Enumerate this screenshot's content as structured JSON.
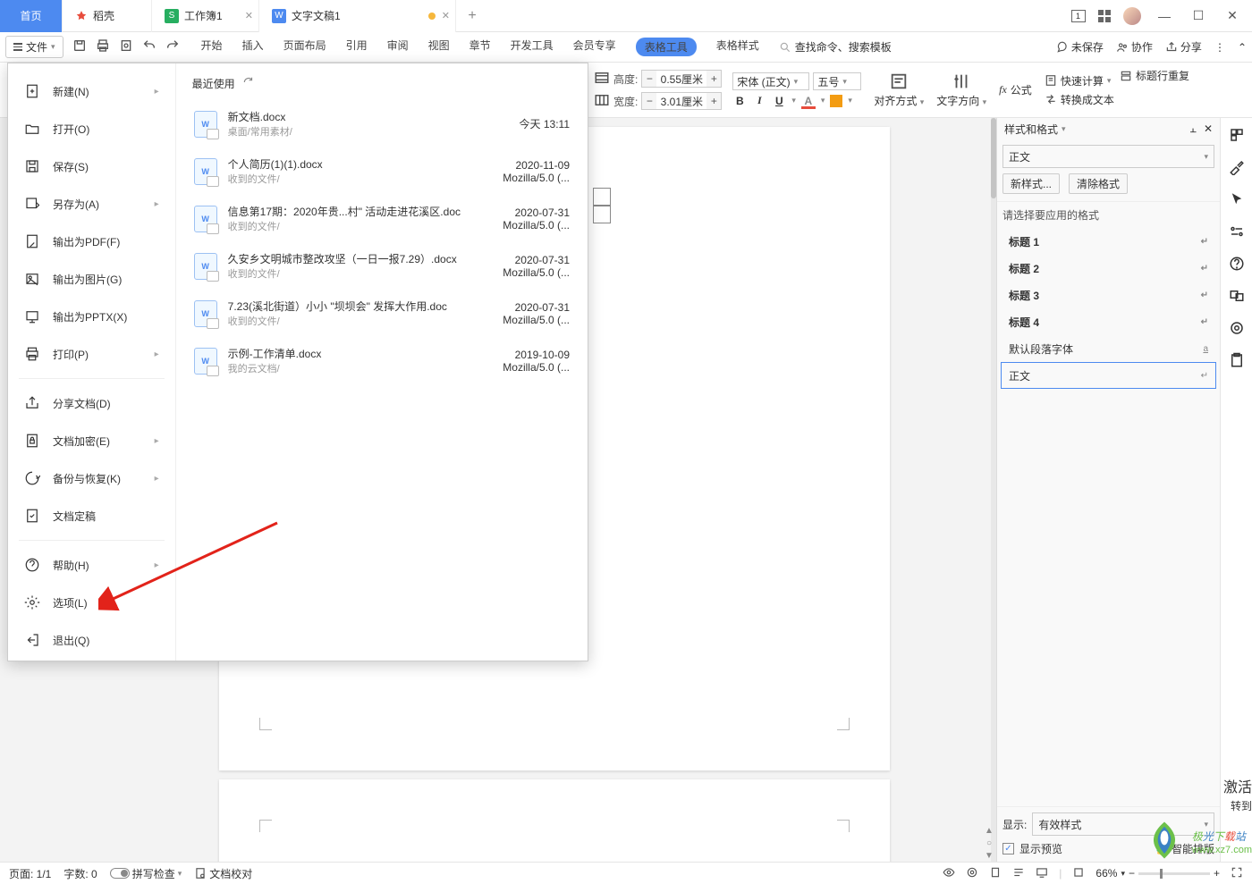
{
  "titlebar": {
    "tabs": [
      {
        "label": "首页",
        "type": "home"
      },
      {
        "label": "稻壳",
        "icon": "#e74c3c"
      },
      {
        "label": "工作簿1",
        "icon": "#27ae60",
        "prefix": "S"
      },
      {
        "label": "文字文稿1",
        "icon": "#4d8af0",
        "prefix": "W",
        "active": true,
        "dirty": true
      }
    ]
  },
  "menubar": {
    "file": "文件",
    "menus": [
      "开始",
      "插入",
      "页面布局",
      "引用",
      "审阅",
      "视图",
      "章节",
      "开发工具",
      "会员专享"
    ],
    "tableTools": "表格工具",
    "tableStyle": "表格样式",
    "search_placeholder": "查找命令、搜索模板",
    "unsaved": "未保存",
    "coop": "协作",
    "share": "分享"
  },
  "ribbon": {
    "height_label": "高度:",
    "width_label": "宽度:",
    "height_val": "0.55厘米",
    "width_val": "3.01厘米",
    "font": "宋体 (正文)",
    "size": "五号",
    "align": "对齐方式",
    "textdir": "文字方向",
    "formula": "fx 公式",
    "quick_calc": "快速计算",
    "title_repeat": "标题行重复",
    "convert": "转换成文本"
  },
  "filemenu": {
    "items": [
      {
        "label": "新建(N)",
        "icon": "new",
        "sub": true
      },
      {
        "label": "打开(O)",
        "icon": "open"
      },
      {
        "label": "保存(S)",
        "icon": "save"
      },
      {
        "label": "另存为(A)",
        "icon": "saveas",
        "sub": true
      },
      {
        "label": "输出为PDF(F)",
        "icon": "pdf"
      },
      {
        "label": "输出为图片(G)",
        "icon": "img"
      },
      {
        "label": "输出为PPTX(X)",
        "icon": "pptx"
      },
      {
        "label": "打印(P)",
        "icon": "print",
        "sub": true
      },
      {
        "sep": true
      },
      {
        "label": "分享文档(D)",
        "icon": "share"
      },
      {
        "label": "文档加密(E)",
        "icon": "lock",
        "sub": true
      },
      {
        "label": "备份与恢复(K)",
        "icon": "backup",
        "sub": true
      },
      {
        "label": "文档定稿",
        "icon": "final"
      },
      {
        "sep": true
      },
      {
        "label": "帮助(H)",
        "icon": "help",
        "sub": true
      },
      {
        "label": "选项(L)",
        "icon": "gear"
      },
      {
        "label": "退出(Q)",
        "icon": "exit"
      }
    ],
    "recent_label": "最近使用",
    "recent": [
      {
        "name": "新文档.docx",
        "path": "桌面/常用素材/",
        "date": "今天  13:11",
        "agent": ""
      },
      {
        "name": "个人简历(1)(1).docx",
        "path": "收到的文件/",
        "date": "2020-11-09",
        "agent": "Mozilla/5.0 (..."
      },
      {
        "name": "信息第17期：2020年贵...村\" 活动走进花溪区.doc",
        "path": "收到的文件/",
        "date": "2020-07-31",
        "agent": "Mozilla/5.0 (..."
      },
      {
        "name": "久安乡文明城市整改攻坚（一日一报7.29）.docx",
        "path": "收到的文件/",
        "date": "2020-07-31",
        "agent": "Mozilla/5.0 (..."
      },
      {
        "name": "7.23(溪北街道）小小 \"坝坝会\"  发挥大作用.doc",
        "path": "收到的文件/",
        "date": "2020-07-31",
        "agent": "Mozilla/5.0 (..."
      },
      {
        "name": "示例-工作清单.docx",
        "path": "我的云文档/",
        "date": "2019-10-09",
        "agent": "Mozilla/5.0 (..."
      }
    ]
  },
  "styles": {
    "title": "样式和格式",
    "current": "正文",
    "new_btn": "新样式...",
    "clear_btn": "清除格式",
    "choose": "请选择要应用的格式",
    "list": [
      {
        "label": "标题 1",
        "h": true
      },
      {
        "label": "标题 2",
        "h": true
      },
      {
        "label": "标题 3",
        "h": true
      },
      {
        "label": "标题 4",
        "h": true
      },
      {
        "label": "默认段落字体",
        "p": true,
        "mark": "a"
      },
      {
        "label": "正文",
        "sel": true
      }
    ],
    "show": "显示:",
    "show_val": "有效样式",
    "preview": "显示预览",
    "smart": "智能排版"
  },
  "status": {
    "page": "页面: 1/1",
    "words": "字数: 0",
    "spell": "拼写检查",
    "proof": "文档校对",
    "zoom": "66%"
  },
  "watermark": {
    "activate": "激活",
    "goto": "转到",
    "brand": "极光下载站",
    "url": "www.xz7.com"
  }
}
